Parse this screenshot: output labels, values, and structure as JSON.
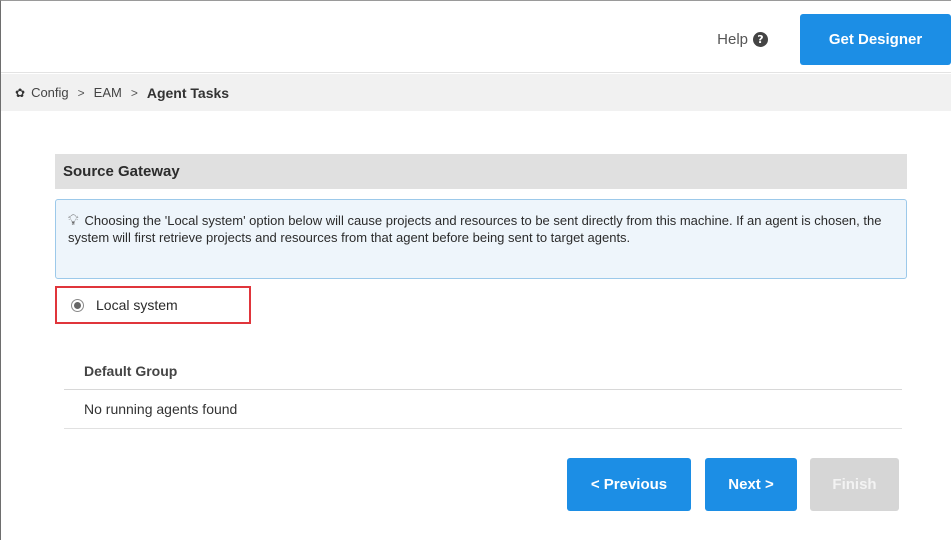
{
  "header": {
    "help_label": "Help",
    "help_icon": "?",
    "get_designer_label": "Get Designer"
  },
  "breadcrumb": {
    "icon": "gear-icon",
    "items": [
      "Config",
      "EAM"
    ],
    "current": "Agent Tasks",
    "separator": ">"
  },
  "section": {
    "title": "Source Gateway",
    "info_text": "Choosing the 'Local system' option below will cause projects and resources to be sent directly from this machine. If an agent is chosen, the system will first retrieve projects and resources from that agent before being sent to target agents.",
    "radio_label": "Local system",
    "radio_selected": true
  },
  "group": {
    "title": "Default Group",
    "empty_text": "No running agents found"
  },
  "footer": {
    "previous_label": "< Previous",
    "next_label": "Next >",
    "finish_label": "Finish"
  },
  "colors": {
    "primary": "#1c8ee5",
    "highlight_border": "#e0353b",
    "info_bg": "#eef5fb",
    "disabled": "#d6d6d6"
  }
}
